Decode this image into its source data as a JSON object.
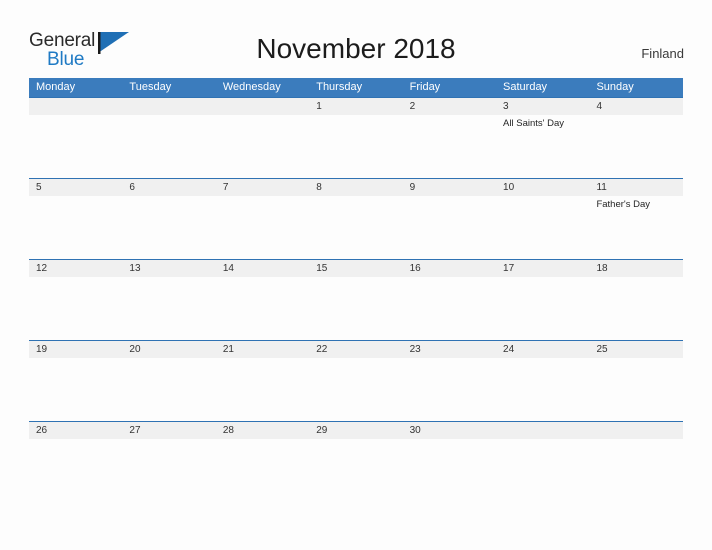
{
  "brand": {
    "name_part1": "General",
    "name_part2": "Blue",
    "flag_icon": "triangle-flag-icon",
    "accent_color": "#1f7ac4"
  },
  "header": {
    "title": "November 2018",
    "locale": "Finland"
  },
  "theme": {
    "header_blue": "#3b7cbd",
    "row_separator_blue": "#2f72b3",
    "date_row_gray": "#f0f0f0",
    "page_background": "#fdfdfd"
  },
  "calendar": {
    "month": "November",
    "year": "2018",
    "weekday_headers": [
      "Monday",
      "Tuesday",
      "Wednesday",
      "Thursday",
      "Friday",
      "Saturday",
      "Sunday"
    ],
    "weeks": [
      {
        "days": [
          {
            "date": "",
            "event": ""
          },
          {
            "date": "",
            "event": ""
          },
          {
            "date": "",
            "event": ""
          },
          {
            "date": "1",
            "event": ""
          },
          {
            "date": "2",
            "event": ""
          },
          {
            "date": "3",
            "event": "All Saints' Day"
          },
          {
            "date": "4",
            "event": ""
          }
        ]
      },
      {
        "days": [
          {
            "date": "5",
            "event": ""
          },
          {
            "date": "6",
            "event": ""
          },
          {
            "date": "7",
            "event": ""
          },
          {
            "date": "8",
            "event": ""
          },
          {
            "date": "9",
            "event": ""
          },
          {
            "date": "10",
            "event": ""
          },
          {
            "date": "11",
            "event": "Father's Day"
          }
        ]
      },
      {
        "days": [
          {
            "date": "12",
            "event": ""
          },
          {
            "date": "13",
            "event": ""
          },
          {
            "date": "14",
            "event": ""
          },
          {
            "date": "15",
            "event": ""
          },
          {
            "date": "16",
            "event": ""
          },
          {
            "date": "17",
            "event": ""
          },
          {
            "date": "18",
            "event": ""
          }
        ]
      },
      {
        "days": [
          {
            "date": "19",
            "event": ""
          },
          {
            "date": "20",
            "event": ""
          },
          {
            "date": "21",
            "event": ""
          },
          {
            "date": "22",
            "event": ""
          },
          {
            "date": "23",
            "event": ""
          },
          {
            "date": "24",
            "event": ""
          },
          {
            "date": "25",
            "event": ""
          }
        ]
      },
      {
        "days": [
          {
            "date": "26",
            "event": ""
          },
          {
            "date": "27",
            "event": ""
          },
          {
            "date": "28",
            "event": ""
          },
          {
            "date": "29",
            "event": ""
          },
          {
            "date": "30",
            "event": ""
          },
          {
            "date": "",
            "event": ""
          },
          {
            "date": "",
            "event": ""
          }
        ]
      }
    ]
  }
}
